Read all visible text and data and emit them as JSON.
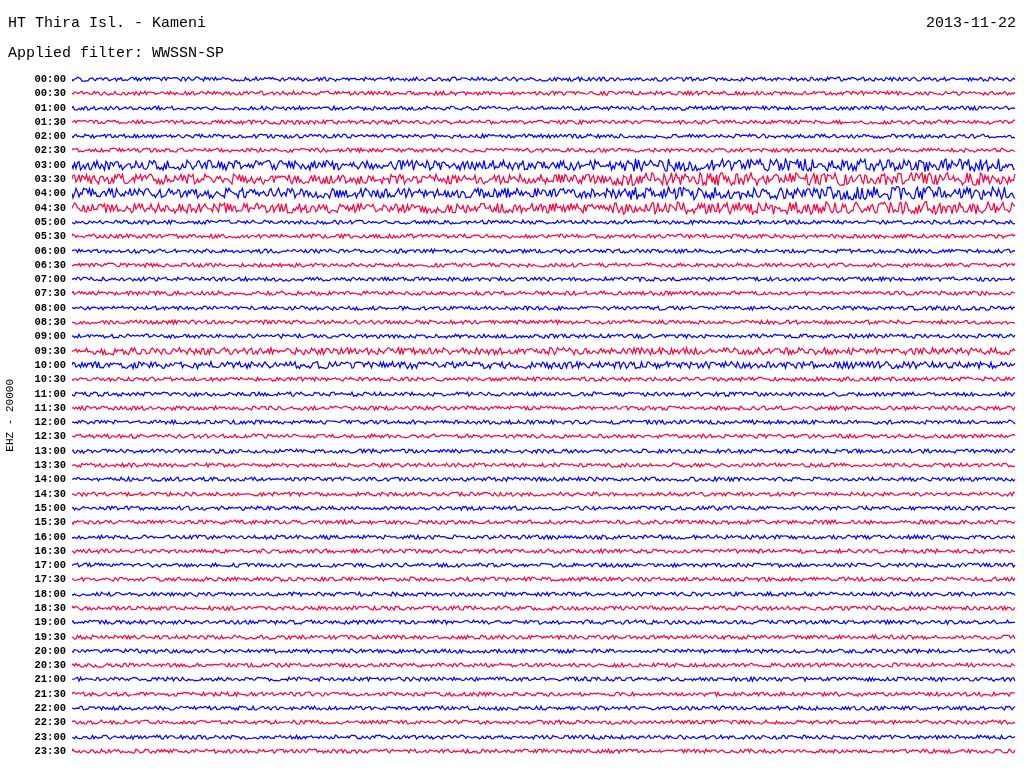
{
  "header": {
    "title": "HT Thira Isl. - Kameni",
    "date": "2013-11-22",
    "filter": "Applied filter: WWSSN-SP"
  },
  "axis_label": "EHZ - 20000",
  "traces": [
    {
      "label": "00:00",
      "color": "#0000ff"
    },
    {
      "label": "00:30",
      "color": "#ff0040"
    },
    {
      "label": "01:00",
      "color": "#0000ff"
    },
    {
      "label": "01:30",
      "color": "#ff0040"
    },
    {
      "label": "02:00",
      "color": "#0000ff"
    },
    {
      "label": "02:30",
      "color": "#ff0040"
    },
    {
      "label": "03:00",
      "color": "#0000ff"
    },
    {
      "label": "03:30",
      "color": "#ff0040"
    },
    {
      "label": "04:00",
      "color": "#0000ff"
    },
    {
      "label": "04:30",
      "color": "#ff0040"
    },
    {
      "label": "05:00",
      "color": "#0000ff"
    },
    {
      "label": "05:30",
      "color": "#ff0040"
    },
    {
      "label": "06:00",
      "color": "#0000ff"
    },
    {
      "label": "06:30",
      "color": "#ff0040"
    },
    {
      "label": "07:00",
      "color": "#0000ff"
    },
    {
      "label": "07:30",
      "color": "#ff0040"
    },
    {
      "label": "08:00",
      "color": "#0000ff"
    },
    {
      "label": "08:30",
      "color": "#ff0040"
    },
    {
      "label": "09:00",
      "color": "#0000ff"
    },
    {
      "label": "09:30",
      "color": "#ff0040"
    },
    {
      "label": "10:00",
      "color": "#0000ff"
    },
    {
      "label": "10:30",
      "color": "#ff0040"
    },
    {
      "label": "11:00",
      "color": "#0000ff"
    },
    {
      "label": "11:30",
      "color": "#ff0040"
    },
    {
      "label": "12:00",
      "color": "#0000ff"
    },
    {
      "label": "12:30",
      "color": "#ff0040"
    },
    {
      "label": "13:00",
      "color": "#0000ff"
    },
    {
      "label": "13:30",
      "color": "#ff0040"
    },
    {
      "label": "14:00",
      "color": "#0000ff"
    },
    {
      "label": "14:30",
      "color": "#ff0040"
    },
    {
      "label": "15:00",
      "color": "#0000ff"
    },
    {
      "label": "15:30",
      "color": "#ff0040"
    },
    {
      "label": "16:00",
      "color": "#0000ff"
    },
    {
      "label": "16:30",
      "color": "#ff0040"
    },
    {
      "label": "17:00",
      "color": "#0000ff"
    },
    {
      "label": "17:30",
      "color": "#ff0040"
    },
    {
      "label": "18:00",
      "color": "#0000ff"
    },
    {
      "label": "18:30",
      "color": "#ff0040"
    },
    {
      "label": "19:00",
      "color": "#0000ff"
    },
    {
      "label": "19:30",
      "color": "#ff0040"
    },
    {
      "label": "20:00",
      "color": "#0000ff"
    },
    {
      "label": "20:30",
      "color": "#ff0040"
    },
    {
      "label": "21:00",
      "color": "#0000ff"
    },
    {
      "label": "21:30",
      "color": "#ff0040"
    },
    {
      "label": "22:00",
      "color": "#0000ff"
    },
    {
      "label": "22:30",
      "color": "#ff0040"
    },
    {
      "label": "23:00",
      "color": "#0000ff"
    },
    {
      "label": "23:30",
      "color": "#ff0040"
    }
  ]
}
